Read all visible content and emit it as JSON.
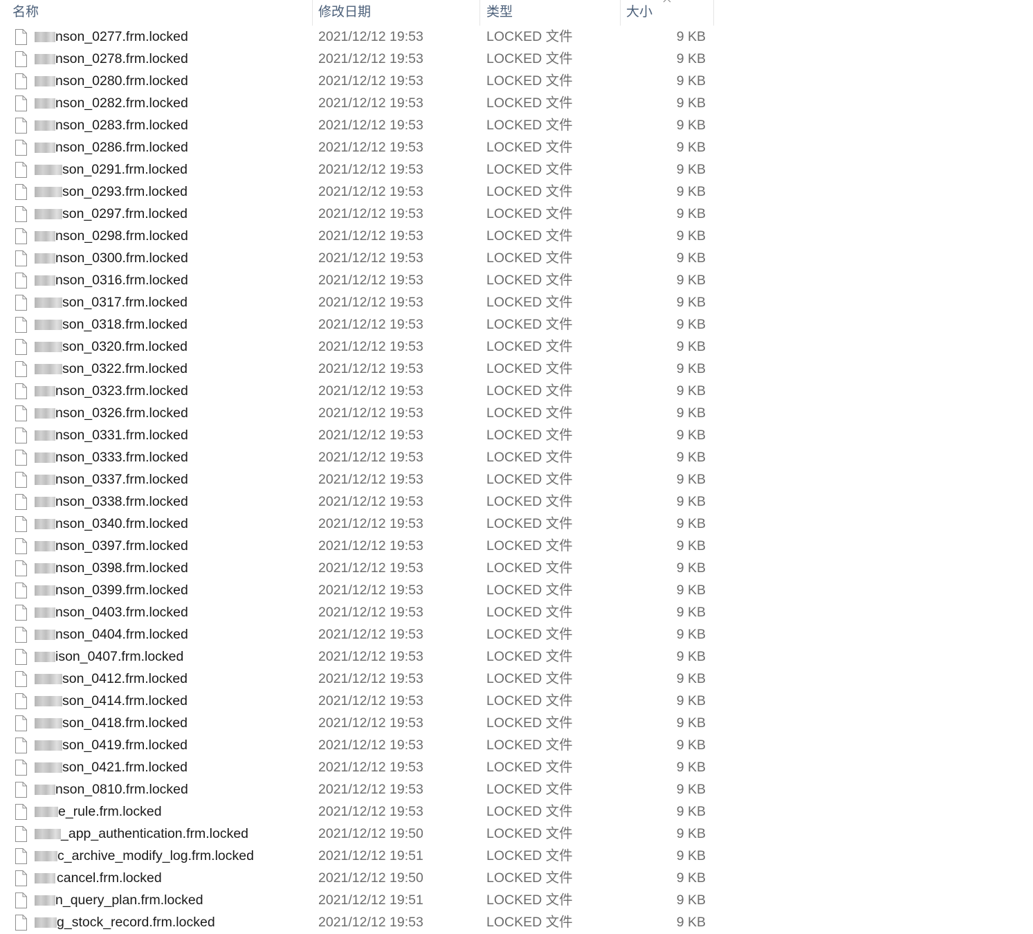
{
  "columns": {
    "name": "名称",
    "date": "修改日期",
    "type": "类型",
    "size": "大小"
  },
  "sort_indicator_icon": "chevron-up-icon",
  "file_icon": "blank-file-icon",
  "files": [
    {
      "name": "nson_0277.frm.locked",
      "date": "2021/12/12 19:53",
      "type": "LOCKED 文件",
      "size": "9 KB"
    },
    {
      "name": "nson_0278.frm.locked",
      "date": "2021/12/12 19:53",
      "type": "LOCKED 文件",
      "size": "9 KB"
    },
    {
      "name": "nson_0280.frm.locked",
      "date": "2021/12/12 19:53",
      "type": "LOCKED 文件",
      "size": "9 KB"
    },
    {
      "name": "nson_0282.frm.locked",
      "date": "2021/12/12 19:53",
      "type": "LOCKED 文件",
      "size": "9 KB"
    },
    {
      "name": "nson_0283.frm.locked",
      "date": "2021/12/12 19:53",
      "type": "LOCKED 文件",
      "size": "9 KB"
    },
    {
      "name": "nson_0286.frm.locked",
      "date": "2021/12/12 19:53",
      "type": "LOCKED 文件",
      "size": "9 KB"
    },
    {
      "name": "son_0291.frm.locked",
      "date": "2021/12/12 19:53",
      "type": "LOCKED 文件",
      "size": "9 KB"
    },
    {
      "name": "son_0293.frm.locked",
      "date": "2021/12/12 19:53",
      "type": "LOCKED 文件",
      "size": "9 KB"
    },
    {
      "name": "son_0297.frm.locked",
      "date": "2021/12/12 19:53",
      "type": "LOCKED 文件",
      "size": "9 KB"
    },
    {
      "name": "nson_0298.frm.locked",
      "date": "2021/12/12 19:53",
      "type": "LOCKED 文件",
      "size": "9 KB"
    },
    {
      "name": "nson_0300.frm.locked",
      "date": "2021/12/12 19:53",
      "type": "LOCKED 文件",
      "size": "9 KB"
    },
    {
      "name": "nson_0316.frm.locked",
      "date": "2021/12/12 19:53",
      "type": "LOCKED 文件",
      "size": "9 KB"
    },
    {
      "name": "son_0317.frm.locked",
      "date": "2021/12/12 19:53",
      "type": "LOCKED 文件",
      "size": "9 KB"
    },
    {
      "name": "son_0318.frm.locked",
      "date": "2021/12/12 19:53",
      "type": "LOCKED 文件",
      "size": "9 KB"
    },
    {
      "name": "son_0320.frm.locked",
      "date": "2021/12/12 19:53",
      "type": "LOCKED 文件",
      "size": "9 KB"
    },
    {
      "name": "son_0322.frm.locked",
      "date": "2021/12/12 19:53",
      "type": "LOCKED 文件",
      "size": "9 KB"
    },
    {
      "name": "nson_0323.frm.locked",
      "date": "2021/12/12 19:53",
      "type": "LOCKED 文件",
      "size": "9 KB"
    },
    {
      "name": "nson_0326.frm.locked",
      "date": "2021/12/12 19:53",
      "type": "LOCKED 文件",
      "size": "9 KB"
    },
    {
      "name": "nson_0331.frm.locked",
      "date": "2021/12/12 19:53",
      "type": "LOCKED 文件",
      "size": "9 KB"
    },
    {
      "name": "nson_0333.frm.locked",
      "date": "2021/12/12 19:53",
      "type": "LOCKED 文件",
      "size": "9 KB"
    },
    {
      "name": "nson_0337.frm.locked",
      "date": "2021/12/12 19:53",
      "type": "LOCKED 文件",
      "size": "9 KB"
    },
    {
      "name": "nson_0338.frm.locked",
      "date": "2021/12/12 19:53",
      "type": "LOCKED 文件",
      "size": "9 KB"
    },
    {
      "name": "nson_0340.frm.locked",
      "date": "2021/12/12 19:53",
      "type": "LOCKED 文件",
      "size": "9 KB"
    },
    {
      "name": "nson_0397.frm.locked",
      "date": "2021/12/12 19:53",
      "type": "LOCKED 文件",
      "size": "9 KB"
    },
    {
      "name": "nson_0398.frm.locked",
      "date": "2021/12/12 19:53",
      "type": "LOCKED 文件",
      "size": "9 KB"
    },
    {
      "name": "nson_0399.frm.locked",
      "date": "2021/12/12 19:53",
      "type": "LOCKED 文件",
      "size": "9 KB"
    },
    {
      "name": "nson_0403.frm.locked",
      "date": "2021/12/12 19:53",
      "type": "LOCKED 文件",
      "size": "9 KB"
    },
    {
      "name": "nson_0404.frm.locked",
      "date": "2021/12/12 19:53",
      "type": "LOCKED 文件",
      "size": "9 KB"
    },
    {
      "name": "ison_0407.frm.locked",
      "date": "2021/12/12 19:53",
      "type": "LOCKED 文件",
      "size": "9 KB"
    },
    {
      "name": "son_0412.frm.locked",
      "date": "2021/12/12 19:53",
      "type": "LOCKED 文件",
      "size": "9 KB"
    },
    {
      "name": "son_0414.frm.locked",
      "date": "2021/12/12 19:53",
      "type": "LOCKED 文件",
      "size": "9 KB"
    },
    {
      "name": "son_0418.frm.locked",
      "date": "2021/12/12 19:53",
      "type": "LOCKED 文件",
      "size": "9 KB"
    },
    {
      "name": "son_0419.frm.locked",
      "date": "2021/12/12 19:53",
      "type": "LOCKED 文件",
      "size": "9 KB"
    },
    {
      "name": "son_0421.frm.locked",
      "date": "2021/12/12 19:53",
      "type": "LOCKED 文件",
      "size": "9 KB"
    },
    {
      "name": "nson_0810.frm.locked",
      "date": "2021/12/12 19:53",
      "type": "LOCKED 文件",
      "size": "9 KB"
    },
    {
      "name": "e_rule.frm.locked",
      "date": "2021/12/12 19:53",
      "type": "LOCKED 文件",
      "size": "9 KB"
    },
    {
      "name": "_app_authentication.frm.locked",
      "date": "2021/12/12 19:50",
      "type": "LOCKED 文件",
      "size": "9 KB"
    },
    {
      "name": "c_archive_modify_log.frm.locked",
      "date": "2021/12/12 19:51",
      "type": "LOCKED 文件",
      "size": "9 KB"
    },
    {
      "name": "cancel.frm.locked",
      "date": "2021/12/12 19:50",
      "type": "LOCKED 文件",
      "size": "9 KB"
    },
    {
      "name": "n_query_plan.frm.locked",
      "date": "2021/12/12 19:51",
      "type": "LOCKED 文件",
      "size": "9 KB"
    },
    {
      "name": "g_stock_record.frm.locked",
      "date": "2021/12/12 19:53",
      "type": "LOCKED 文件",
      "size": "9 KB"
    }
  ]
}
